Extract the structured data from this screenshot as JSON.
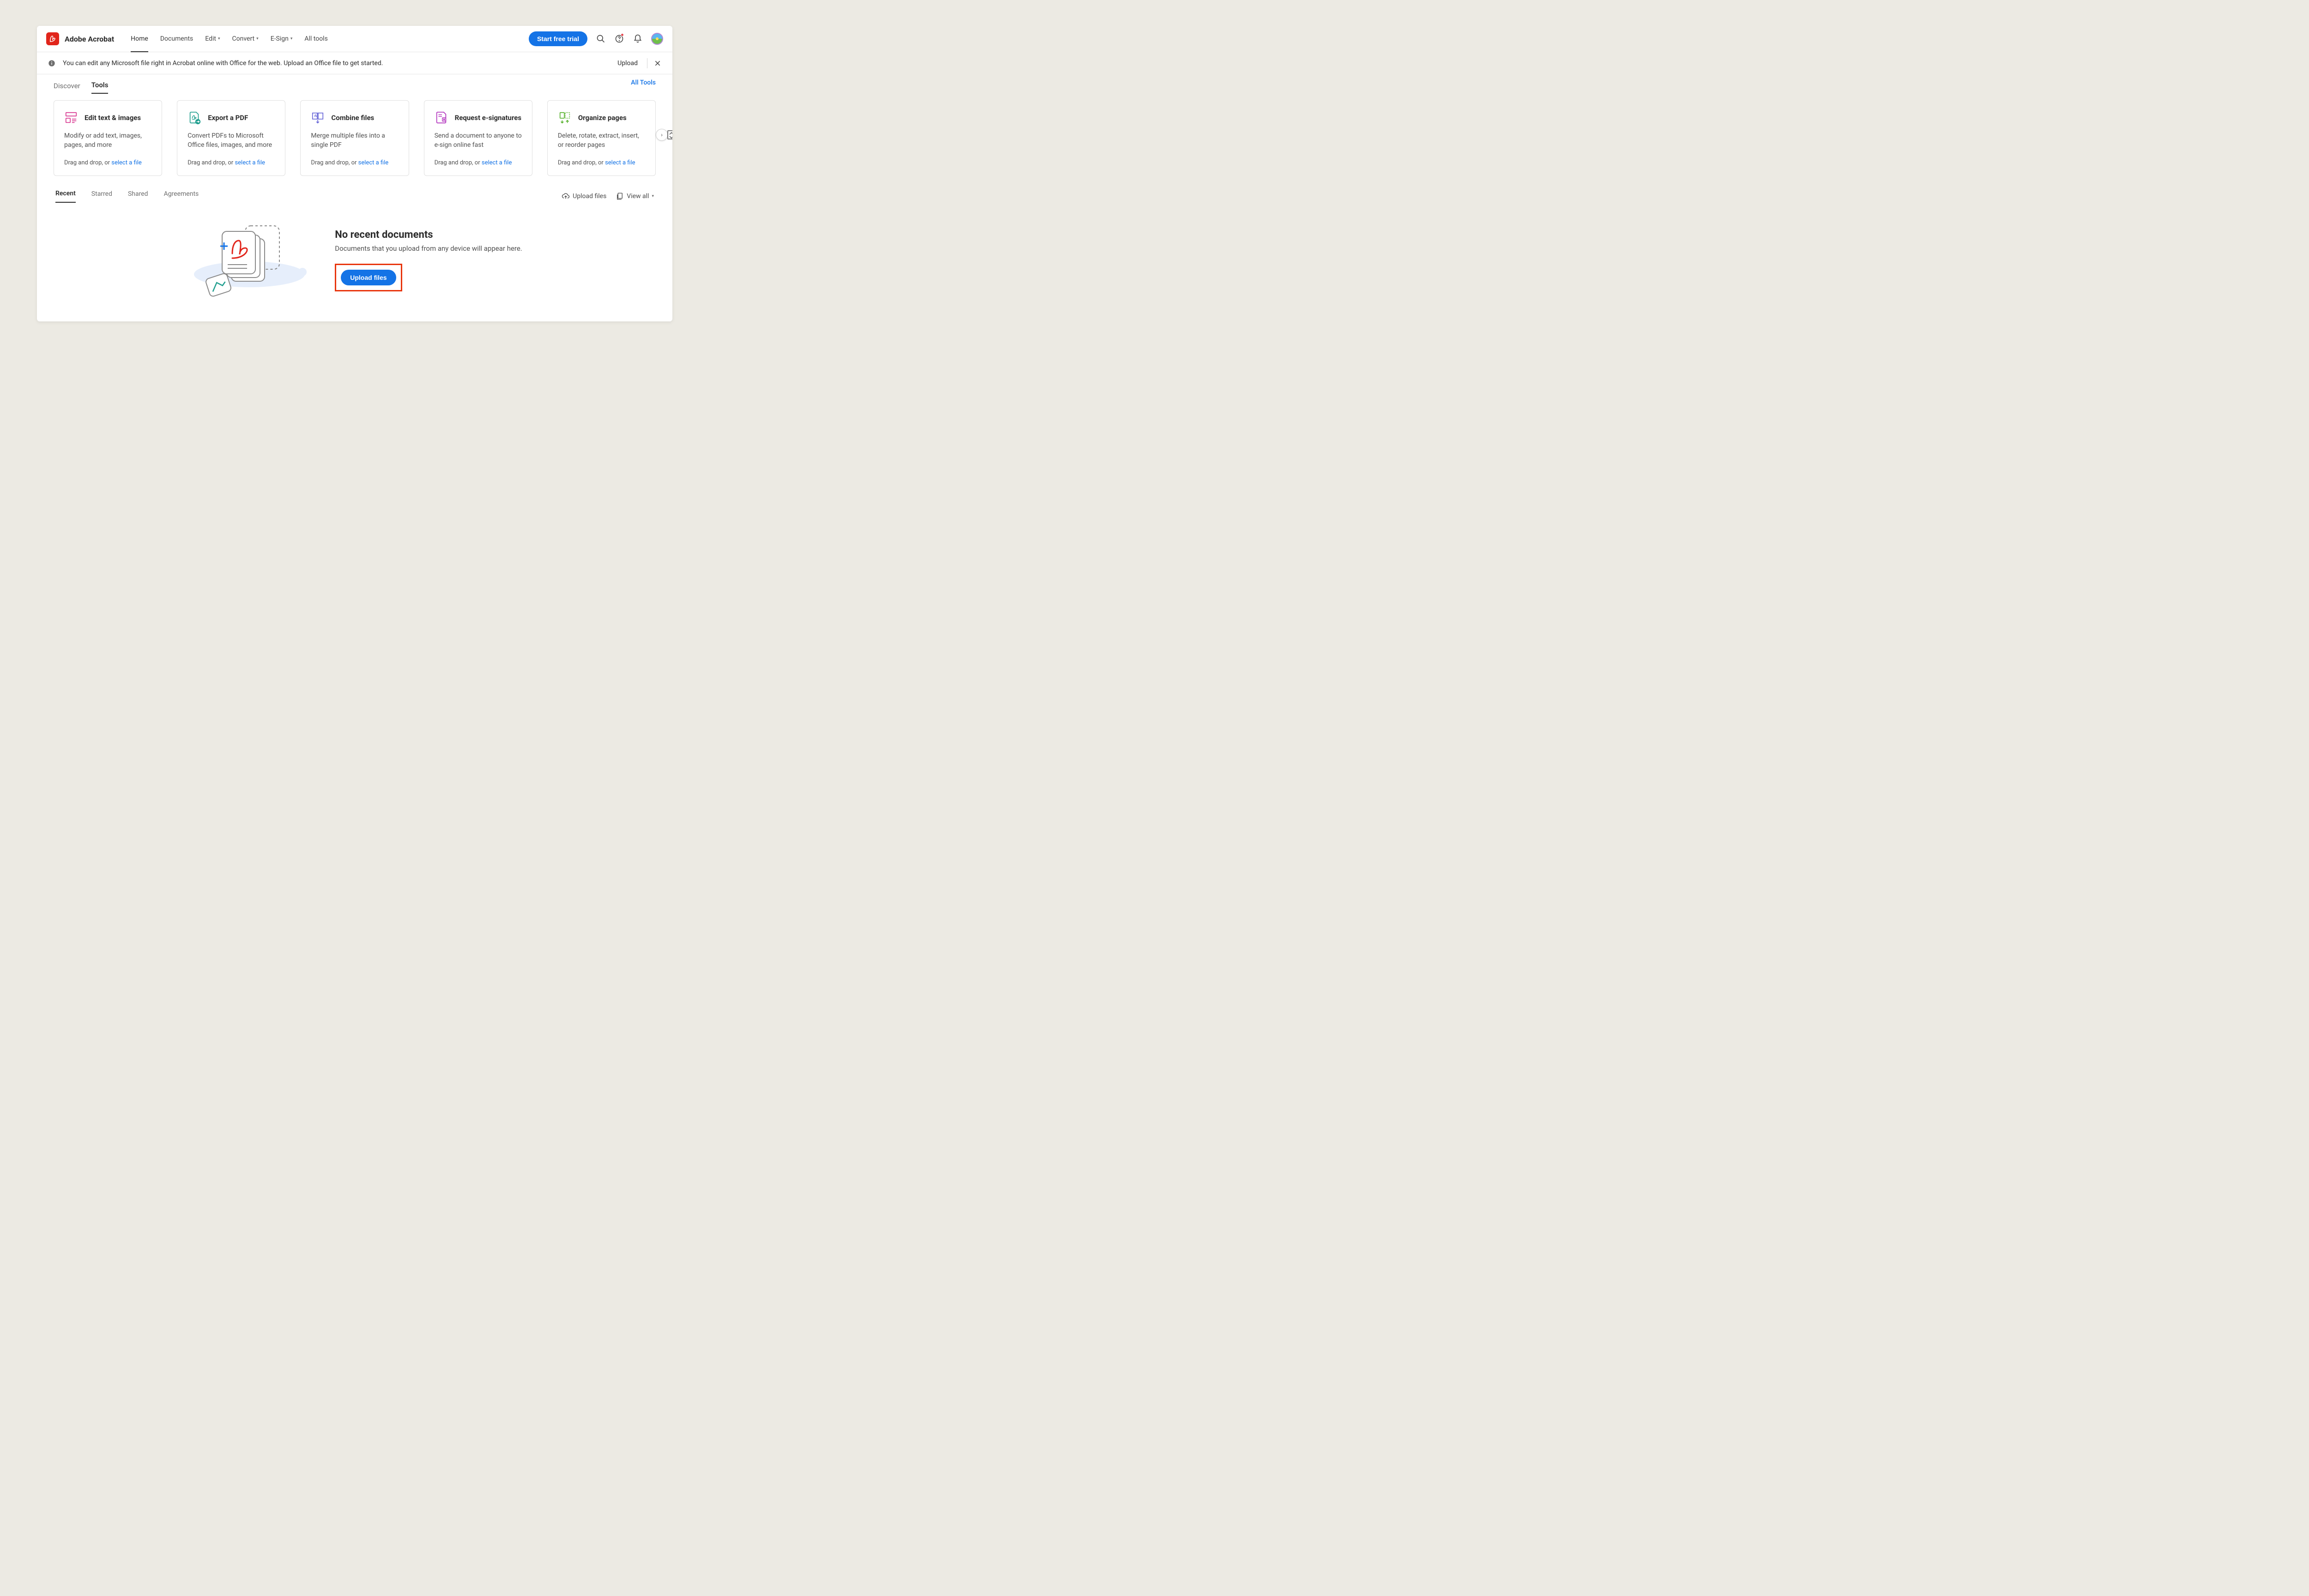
{
  "brand": "Adobe Acrobat",
  "nav": {
    "items": [
      "Home",
      "Documents",
      "Edit",
      "Convert",
      "E-Sign",
      "All tools"
    ],
    "dropdown": [
      false,
      false,
      true,
      true,
      true,
      false
    ],
    "active": "Home",
    "trial": "Start free trial"
  },
  "banner": {
    "text": "You can edit any Microsoft file right in Acrobat online with Office for the web. Upload an Office file to get started.",
    "upload": "Upload"
  },
  "subtabs": {
    "items": [
      "Discover",
      "Tools"
    ],
    "active": "Tools",
    "alltools": "All Tools"
  },
  "cards": [
    {
      "title": "Edit text & images",
      "desc": "Modify or add text, images, pages, and more",
      "drop": "Drag and drop, or ",
      "link": "select a file",
      "iconcolor": "#d83790"
    },
    {
      "title": "Export a PDF",
      "desc": "Convert PDFs to Microsoft Office files, images, and more",
      "drop": "Drag and drop, or ",
      "link": "select a file",
      "iconcolor": "#1f9e8e"
    },
    {
      "title": "Combine files",
      "desc": "Merge multiple files into a single PDF",
      "drop": "Drag and drop, or ",
      "link": "select a file",
      "iconcolor": "#6968d8"
    },
    {
      "title": "Request e-signatures",
      "desc": "Send a document to anyone to e-sign online fast",
      "drop": "Drag and drop, or ",
      "link": "select a file",
      "iconcolor": "#b130bd"
    },
    {
      "title": "Organize pages",
      "desc": "Delete, rotate, extract, insert, or reorder pages",
      "drop": "Drag and drop, or ",
      "link": "select a file",
      "iconcolor": "#59b22f"
    }
  ],
  "recenttabs": {
    "items": [
      "Recent",
      "Starred",
      "Shared",
      "Agreements"
    ],
    "active": "Recent"
  },
  "recentright": {
    "upload": "Upload files",
    "viewall": "View all"
  },
  "empty": {
    "title": "No recent documents",
    "sub": "Documents that you upload from any device will appear here.",
    "button": "Upload files"
  }
}
